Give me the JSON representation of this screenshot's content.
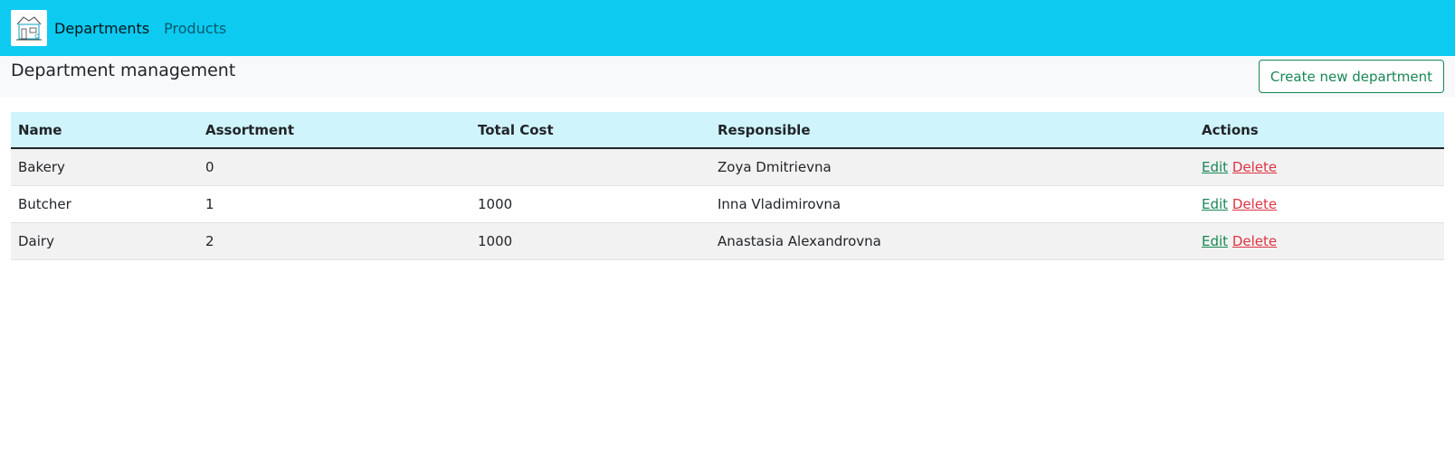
{
  "navbar": {
    "links": [
      {
        "label": "Departments",
        "active": true
      },
      {
        "label": "Products",
        "active": false
      }
    ],
    "bg_color": "#0dcaf0"
  },
  "header": {
    "title": "Department management",
    "create_button_label": "Create new department"
  },
  "table": {
    "columns": [
      "Name",
      "Assortment",
      "Total Cost",
      "Responsible",
      "Actions"
    ],
    "rows": [
      {
        "name": "Bakery",
        "assortment": "0",
        "total_cost": "",
        "responsible": "Zoya Dmitrievna",
        "edit": "Edit",
        "delete": "Delete"
      },
      {
        "name": "Butcher",
        "assortment": "1",
        "total_cost": "1000",
        "responsible": "Inna Vladimirovna",
        "edit": "Edit",
        "delete": "Delete"
      },
      {
        "name": "Dairy",
        "assortment": "2",
        "total_cost": "1000",
        "responsible": "Anastasia Alexandrovna",
        "edit": "Edit",
        "delete": "Delete"
      }
    ]
  },
  "colors": {
    "accent_green": "#198754",
    "danger_red": "#dc3545",
    "table_header_bg": "#cff4fc"
  }
}
